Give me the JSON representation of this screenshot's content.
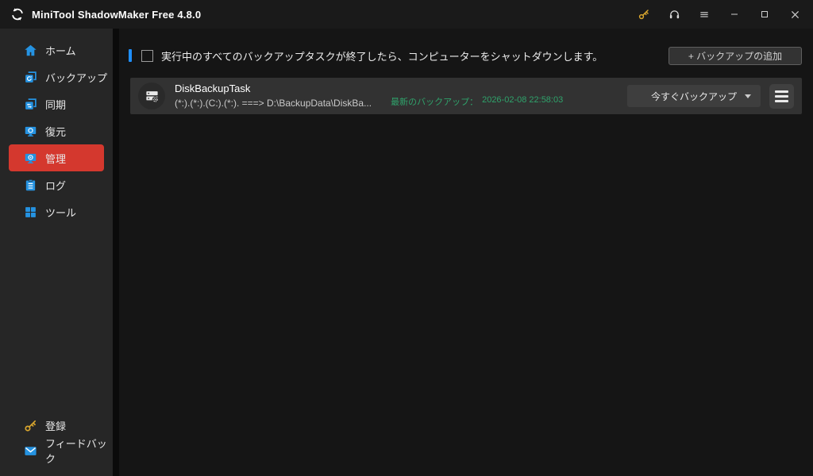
{
  "titlebar": {
    "title": "MiniTool ShadowMaker Free 4.8.0",
    "icons": [
      "app-logo-sync-icon",
      "license-key-icon",
      "support-headset-icon",
      "menu-icon",
      "minimize-icon",
      "maximize-icon",
      "close-icon"
    ]
  },
  "sidebar": {
    "items": [
      {
        "label": "ホーム",
        "icon": "home-icon",
        "selected": false
      },
      {
        "label": "バックアップ",
        "icon": "backup-icon",
        "selected": false
      },
      {
        "label": "同期",
        "icon": "sync-icon",
        "selected": false
      },
      {
        "label": "復元",
        "icon": "restore-icon",
        "selected": false
      },
      {
        "label": "管理",
        "icon": "manage-icon",
        "selected": true
      },
      {
        "label": "ログ",
        "icon": "log-icon",
        "selected": false
      },
      {
        "label": "ツール",
        "icon": "tools-icon",
        "selected": false
      }
    ],
    "bottom_items": [
      {
        "label": "登録",
        "icon": "register-key-icon"
      },
      {
        "label": "フィードバック",
        "icon": "feedback-mail-icon"
      }
    ]
  },
  "main": {
    "shutdown_option": {
      "label": "実行中のすべてのバックアップタスクが終了したら、コンピューターをシャットダウンします。",
      "checked": false
    },
    "add_backup_button_label": "+ バックアップの追加",
    "task_card": {
      "name": "DiskBackupTask",
      "path_summary": "(*:).(*:).(C:).(*:). ===> D:\\BackupData\\DiskBa...",
      "latest_backup_label": "最新のバックアップ：",
      "latest_backup_time": "2026-02-08 22:58:03",
      "backup_now_button_label": "今すぐバックアップ",
      "task_icon": "disk-backup-task-icon",
      "more_menu_icon": "hamburger-menu-icon"
    }
  },
  "colors": {
    "accent_red": "#d4382e",
    "icon_blue": "#2593e2",
    "accent_blue_bar": "#1f8fff",
    "success_green": "#2fa36b",
    "key_gold": "#d9a62e",
    "titlebar_bg": "#1a1a1a",
    "sidebar_bg": "#262626",
    "main_bg": "#151515",
    "card_bg": "#323232"
  }
}
